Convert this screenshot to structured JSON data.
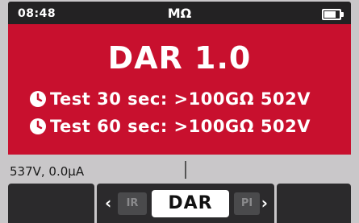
{
  "status_bar": {
    "time": "08:48",
    "unit": "MΩ",
    "battery_icon": "battery-icon"
  },
  "main": {
    "title": "DAR 1.0",
    "results": [
      {
        "icon": "clock-icon",
        "text": "Test 30 sec: >100GΩ 502V"
      },
      {
        "icon": "clock-icon",
        "text": "Test 60 sec: >100GΩ 502V"
      }
    ]
  },
  "info_bar": {
    "reading": "537V, 0.0µA"
  },
  "softkeys": {
    "left_arrow": "‹",
    "right_arrow": "›",
    "options": {
      "prev": "IR",
      "selected": "DAR",
      "next": "PI"
    }
  },
  "colors": {
    "accent": "#c8102e",
    "status_bar": "#232223",
    "softkey": "#2b2a2c",
    "background": "#c9c7c9"
  }
}
